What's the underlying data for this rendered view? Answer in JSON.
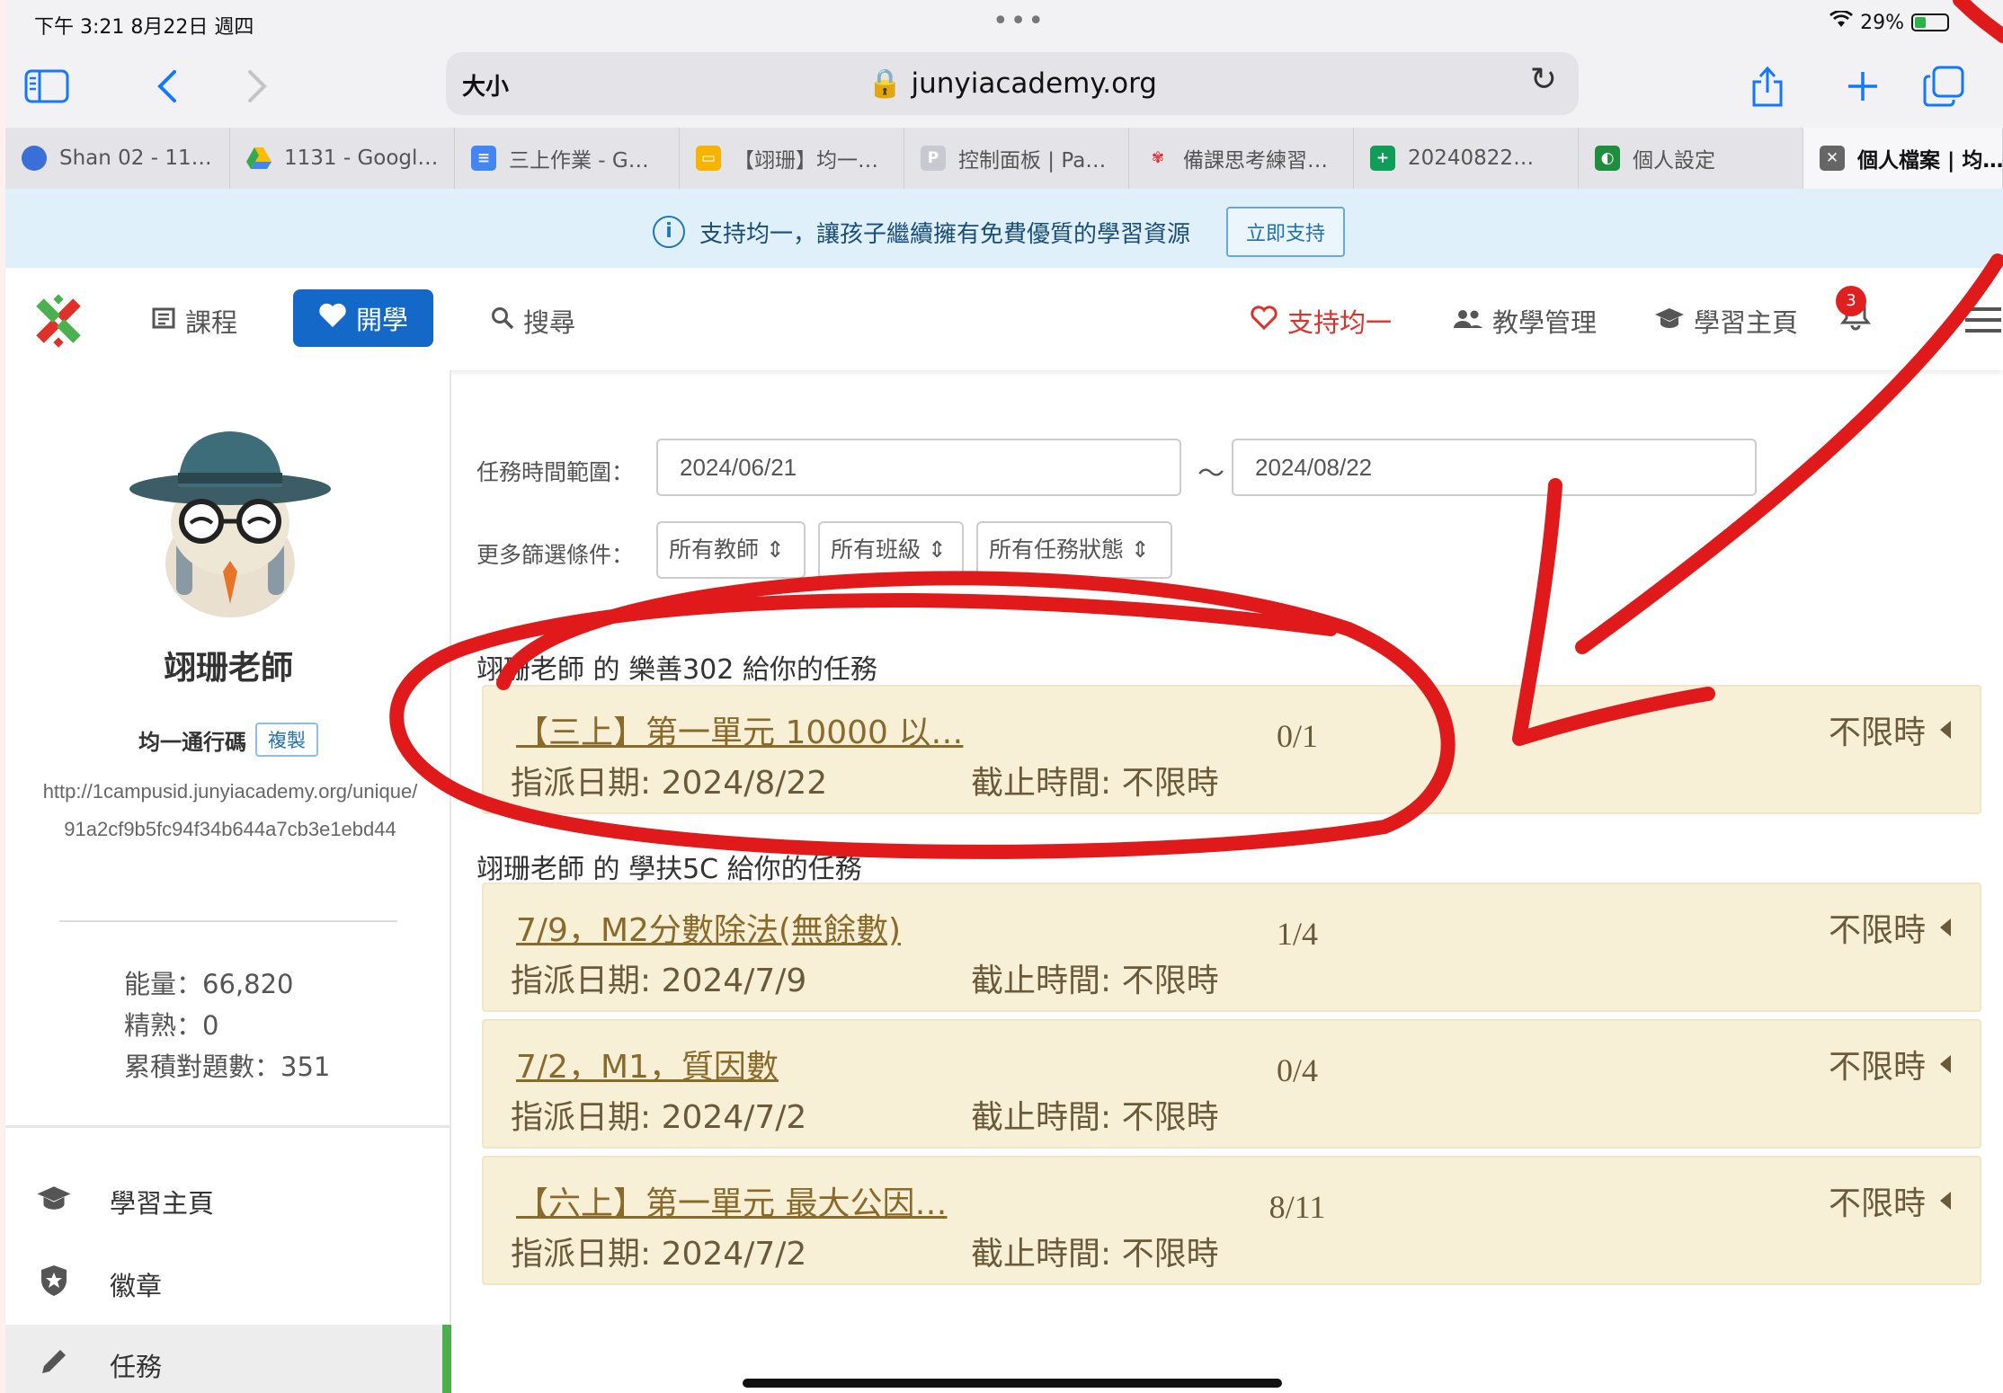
{
  "status_bar": {
    "time": "下午 3:21   8月22日 週四",
    "battery": "29%"
  },
  "browser": {
    "size_label": "大小",
    "url": "junyiacademy.org",
    "tabs": [
      {
        "label": "Shan 02 - 11…",
        "icon": "chrome-icon"
      },
      {
        "label": "1131 - Googl…",
        "icon": "google-drive-icon"
      },
      {
        "label": "三上作業 - G…",
        "icon": "google-docs-icon"
      },
      {
        "label": "【翊珊】均一…",
        "icon": "google-slides-icon"
      },
      {
        "label": "控制面板 | Pa…",
        "icon": "padlet-icon"
      },
      {
        "label": "備課思考練習…",
        "icon": "junyi-icon"
      },
      {
        "label": "20240822…",
        "icon": "google-sheets-icon"
      },
      {
        "label": "個人設定",
        "icon": "google-classroom-icon"
      },
      {
        "label": "個人檔案 | 均…",
        "icon": "close-tab-icon"
      }
    ]
  },
  "banner": {
    "text": "支持均一，讓孩子繼續擁有免費優質的學習資源",
    "button": "立即支持"
  },
  "nav": {
    "courses": "課程",
    "teach": "開學",
    "search": "搜尋",
    "support": "支持均一",
    "teaching_mgmt": "教學管理",
    "learning_home": "學習主頁",
    "notification_count": "3"
  },
  "sidebar": {
    "teacher_name": "翊珊老師",
    "pass_label": "均一通行碼",
    "copy_button": "複製",
    "url": "http://1campusid.junyiacademy.org/unique/91a2cf9b5fc94f34b644a7cb3e1ebd44",
    "stats": {
      "energy": "能量：66,820",
      "mastery": "精熟：0",
      "answers": "累積對題數：351"
    },
    "menu": [
      {
        "label": "學習主頁",
        "icon": "graduation-cap-icon"
      },
      {
        "label": "徽章",
        "icon": "shield-star-icon"
      },
      {
        "label": "任務",
        "icon": "pencil-icon"
      }
    ]
  },
  "filters": {
    "range_label": "任務時間範圍：",
    "start_date": "2024/06/21",
    "tilde": "～",
    "end_date": "2024/08/22",
    "more_label": "更多篩選條件：",
    "teacher_select": "所有教師",
    "class_select": "所有班級",
    "status_select": "所有任務狀態"
  },
  "groups": [
    {
      "title": "翊珊老師 的 樂善302 給你的任務",
      "tasks": [
        {
          "title": "【三上】第一單元 10000 以…",
          "progress": "0/1",
          "assigned": "指派日期: 2024/8/22",
          "deadline": "截止時間: 不限時",
          "time_limit": "不限時"
        }
      ]
    },
    {
      "title": "翊珊老師 的 學扶5C 給你的任務",
      "tasks": [
        {
          "title": "7/9，M2分數除法(無餘數)",
          "progress": "1/4",
          "assigned": "指派日期: 2024/7/9",
          "deadline": "截止時間: 不限時",
          "time_limit": "不限時"
        },
        {
          "title": "7/2，M1，質因數",
          "progress": "0/4",
          "assigned": "指派日期: 2024/7/2",
          "deadline": "截止時間: 不限時",
          "time_limit": "不限時"
        },
        {
          "title": "【六上】第一單元 最大公因…",
          "progress": "8/11",
          "assigned": "指派日期: 2024/7/2",
          "deadline": "截止時間: 不限時",
          "time_limit": "不限時"
        }
      ]
    }
  ],
  "annotation": {
    "color": "#e01a1a"
  }
}
